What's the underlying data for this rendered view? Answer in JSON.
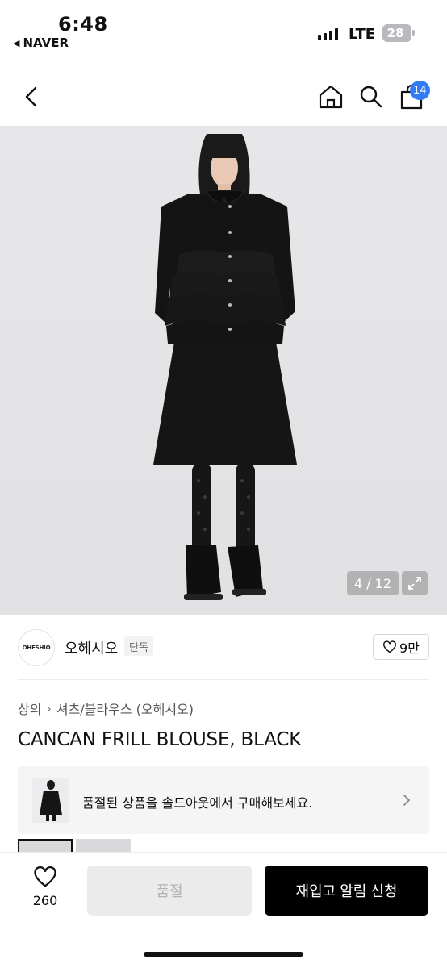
{
  "status_bar": {
    "time": "6:48",
    "back_app": "NAVER",
    "network": "LTE",
    "battery": "28"
  },
  "header": {
    "cart_badge": "14"
  },
  "gallery": {
    "counter": "4 / 12"
  },
  "brand": {
    "logo_text": "OHESHIO",
    "name": "오헤시오",
    "tag": "단독",
    "likes": "9만"
  },
  "breadcrumb": {
    "category": "상의",
    "subcategory": "셔츠/블라우스 (오헤시오)"
  },
  "product": {
    "title": "CANCAN FRILL BLOUSE, BLACK"
  },
  "soldout_banner": {
    "text": "품절된 상품을 솔드아웃에서 구매해보세요."
  },
  "bottom_bar": {
    "wish_count": "260",
    "soldout_label": "품절",
    "restock_label": "재입고 알림 신청"
  },
  "icons": [
    "chevron-left-icon",
    "home-icon",
    "search-icon",
    "shopping-bag-icon",
    "expand-icon",
    "heart-icon",
    "chevron-right-icon"
  ],
  "colors": {
    "accent_badge": "#2f7cf6",
    "primary_button": "#000000",
    "disabled_button": "#ebebeb"
  }
}
